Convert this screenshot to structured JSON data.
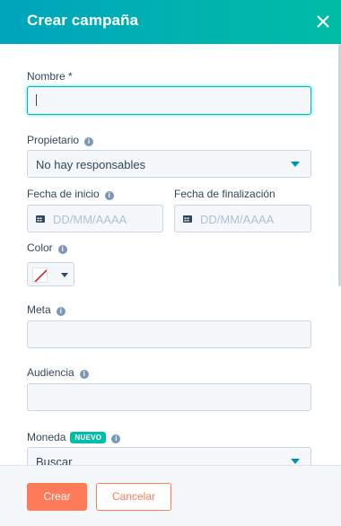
{
  "header": {
    "title": "Crear campaña",
    "close_icon": "close-icon"
  },
  "form": {
    "name": {
      "label": "Nombre *",
      "value": ""
    },
    "owner": {
      "label": "Propietario",
      "value": "No hay responsables"
    },
    "start_date": {
      "label": "Fecha de inicio",
      "placeholder": "DD/MM/AAAA"
    },
    "end_date": {
      "label": "Fecha de finalización",
      "placeholder": "DD/MM/AAAA"
    },
    "color": {
      "label": "Color",
      "value": "none"
    },
    "goal": {
      "label": "Meta",
      "value": ""
    },
    "audience": {
      "label": "Audiencia",
      "value": ""
    },
    "currency": {
      "label": "Moneda",
      "badge": "NUEVO",
      "value": "Buscar"
    }
  },
  "footer": {
    "create_label": "Crear",
    "cancel_label": "Cancelar"
  },
  "colors": {
    "header_start": "#00a4bd",
    "header_end": "#00bda5",
    "accent": "#ff7a59",
    "link": "#0091ae",
    "badge": "#00bda5"
  }
}
